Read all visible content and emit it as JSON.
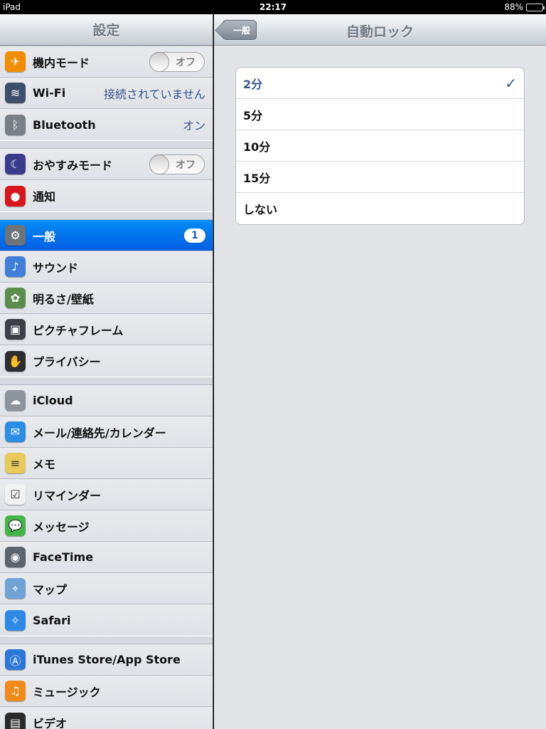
{
  "status_bar": {
    "carrier": "iPad",
    "time": "22:17",
    "battery": "88%",
    "battery_level": 0.88
  },
  "sidebar": {
    "title": "設定",
    "groups": [
      [
        {
          "name": "airplane-mode",
          "label": "機内モード",
          "icon": "airplane-icon",
          "icon_color": "#f28d00",
          "toggle": "オフ"
        },
        {
          "name": "wifi",
          "label": "Wi-Fi",
          "icon": "wifi-icon",
          "icon_color": "#3e4f6b",
          "value": "接続されていません"
        },
        {
          "name": "bluetooth",
          "label": "Bluetooth",
          "icon": "bluetooth-icon",
          "icon_color": "#7a7f86",
          "value": "オン"
        }
      ],
      [
        {
          "name": "do-not-disturb",
          "label": "おやすみモード",
          "icon": "moon-icon",
          "icon_color": "#3a3b8c",
          "toggle": "オフ"
        },
        {
          "name": "notifications",
          "label": "通知",
          "icon": "notification-icon",
          "icon_color": "#d8161b"
        }
      ],
      [
        {
          "name": "general",
          "label": "一般",
          "icon": "gear-icon",
          "icon_color": "#6e737a",
          "badge": "1",
          "selected": true
        },
        {
          "name": "sounds",
          "label": "サウンド",
          "icon": "speaker-icon",
          "icon_color": "#3f7fd9"
        },
        {
          "name": "brightness",
          "label": "明るさ/壁紙",
          "icon": "flower-icon",
          "icon_color": "#5c8d4c"
        },
        {
          "name": "picture-frame",
          "label": "ピクチャフレーム",
          "icon": "picture-frame-icon",
          "icon_color": "#3c4046"
        },
        {
          "name": "privacy",
          "label": "プライバシー",
          "icon": "hand-icon",
          "icon_color": "#2c2e32"
        }
      ],
      [
        {
          "name": "icloud",
          "label": "iCloud",
          "icon": "cloud-icon",
          "icon_color": "#8c939b"
        },
        {
          "name": "mail",
          "label": "メール/連絡先/カレンダー",
          "icon": "mail-icon",
          "icon_color": "#2b8de5"
        },
        {
          "name": "notes",
          "label": "メモ",
          "icon": "notes-icon",
          "icon_color": "#e8c95c"
        },
        {
          "name": "reminders",
          "label": "リマインダー",
          "icon": "reminders-icon",
          "icon_color": "#f2f2f2"
        },
        {
          "name": "messages",
          "label": "メッセージ",
          "icon": "message-icon",
          "icon_color": "#44b649"
        },
        {
          "name": "facetime",
          "label": "FaceTime",
          "icon": "camera-icon",
          "icon_color": "#5d636a"
        },
        {
          "name": "maps",
          "label": "マップ",
          "icon": "map-icon",
          "icon_color": "#6fa3d6"
        },
        {
          "name": "safari",
          "label": "Safari",
          "icon": "compass-icon",
          "icon_color": "#2d89e6"
        }
      ],
      [
        {
          "name": "itunes",
          "label": "iTunes Store/App Store",
          "icon": "app-store-icon",
          "icon_color": "#2a77d8"
        },
        {
          "name": "music",
          "label": "ミュージック",
          "icon": "music-icon",
          "icon_color": "#f28a1a"
        },
        {
          "name": "videos",
          "label": "ビデオ",
          "icon": "clapper-icon",
          "icon_color": "#2a2a2a"
        }
      ]
    ]
  },
  "detail": {
    "back_label": "一般",
    "title": "自動ロック",
    "options": [
      {
        "label": "2分",
        "checked": true
      },
      {
        "label": "5分",
        "checked": false
      },
      {
        "label": "10分",
        "checked": false
      },
      {
        "label": "15分",
        "checked": false
      },
      {
        "label": "しない",
        "checked": false
      }
    ],
    "checkmark": "✓"
  }
}
